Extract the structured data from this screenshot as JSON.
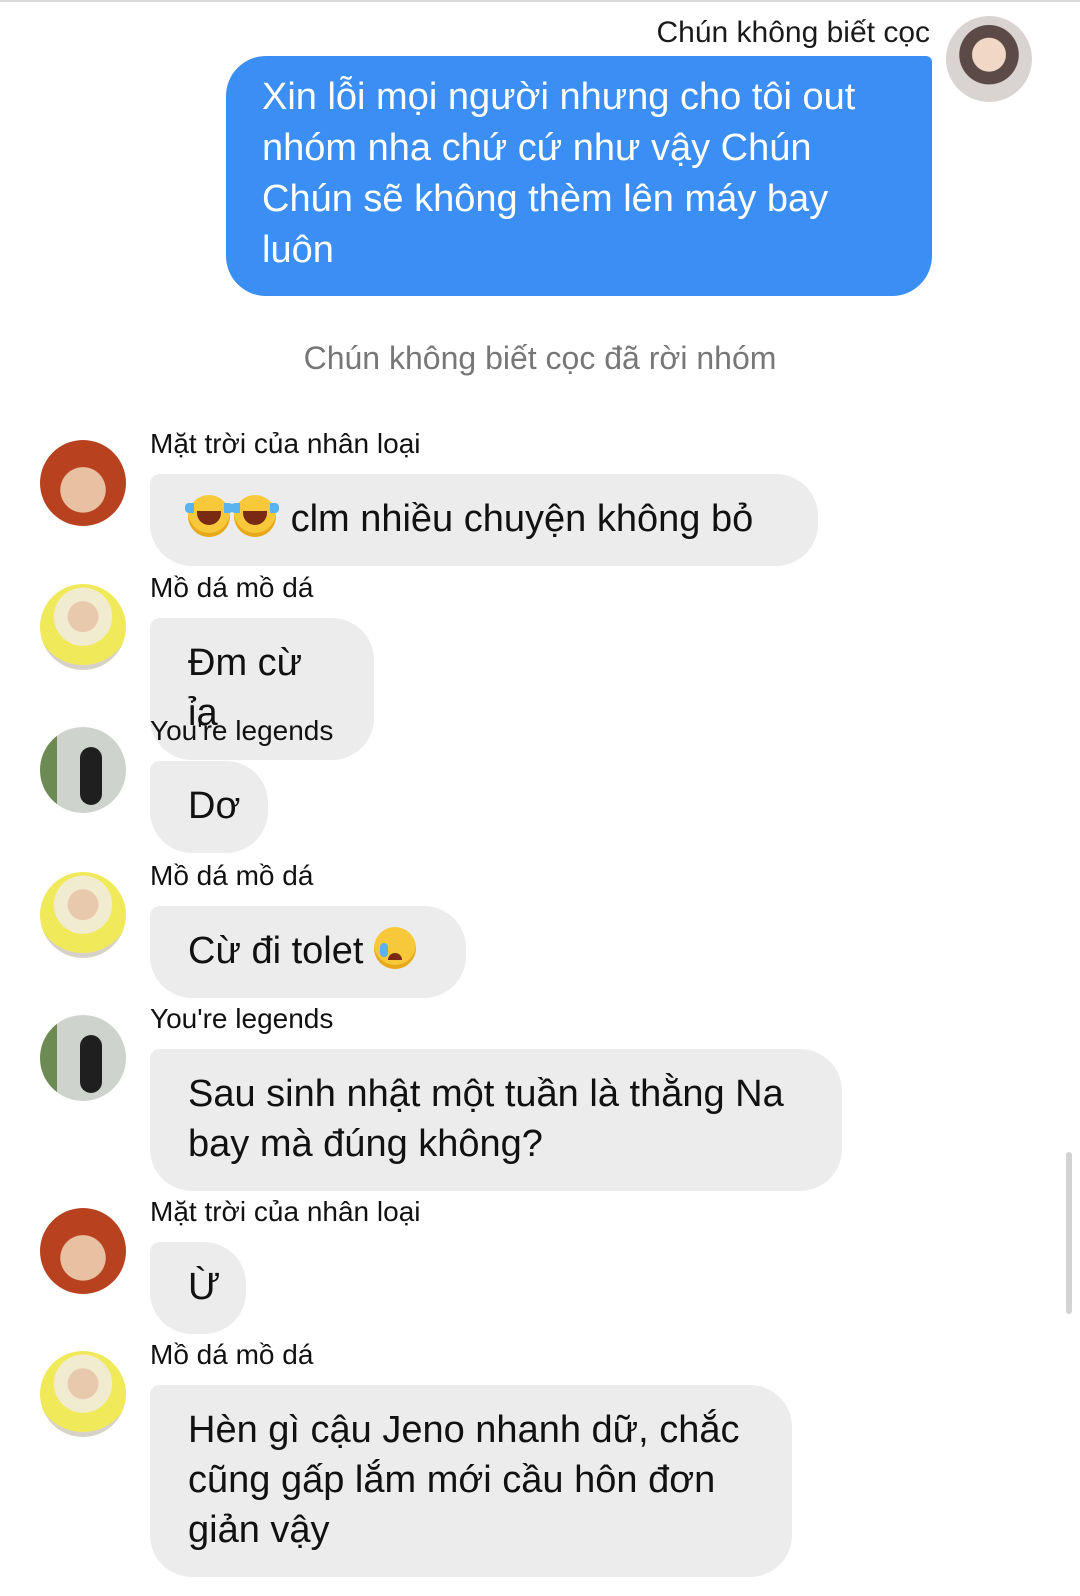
{
  "self": {
    "name": "Chún không biết cọc",
    "message": "Xin lỗi mọi người nhưng cho tôi out nhóm nha chứ cứ như vậy Chún Chún sẽ không thèm lên máy bay luôn"
  },
  "system": {
    "text": "Chún không biết cọc đã rời nhóm"
  },
  "messages": [
    {
      "sender": "Mặt trời của nhân loại",
      "text": "clm nhiều chuyện không bỏ",
      "emoji": "laughing-crying-face"
    },
    {
      "sender": "Mồ dá mồ dá",
      "text": "Đm cừ ỉa"
    },
    {
      "sender": "You're legends",
      "text": "Dơ"
    },
    {
      "sender": "Mồ dá mồ dá",
      "text": "Cừ đi tolet",
      "emoji": "crying-face"
    },
    {
      "sender": "You're legends",
      "text": "Sau sinh nhật một tuần là thằng Na bay mà đúng không?"
    },
    {
      "sender": "Mặt trời của nhân loại",
      "text": "Ừ"
    },
    {
      "sender": "Mồ dá mồ dá",
      "text": "Hèn gì cậu Jeno nhanh dữ, chắc cũng gấp lắm mới cầu hôn đơn giản vậy"
    }
  ],
  "colors": {
    "outgoing_bubble": "#3b8ef3",
    "incoming_bubble": "#ececec",
    "system_text": "#777777"
  }
}
